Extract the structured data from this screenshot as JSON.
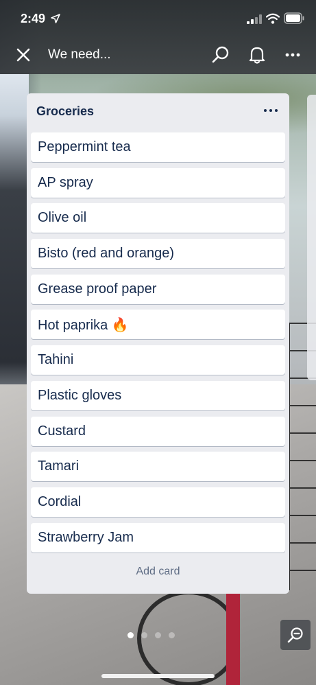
{
  "status_bar": {
    "time": "2:49"
  },
  "header": {
    "board_title": "We need..."
  },
  "list": {
    "title": "Groceries",
    "cards": [
      "Peppermint tea",
      "AP spray",
      "Olive oil",
      "Bisto (red and orange)",
      "Grease proof paper",
      "Hot paprika 🔥",
      "Tahini",
      "Plastic gloves",
      "Custard",
      "Tamari",
      "Cordial",
      "Strawberry Jam"
    ],
    "add_card_label": "Add card"
  },
  "pagination": {
    "total": 4,
    "active_index": 0
  },
  "icons": {
    "close": "close-icon",
    "search": "search-icon",
    "notifications": "bell-icon",
    "more": "more-icon",
    "list_menu": "more-icon",
    "zoom": "zoom-out-icon"
  },
  "colors": {
    "list_bg": "#ebecf0",
    "card_text": "#172b4d",
    "add_card_text": "#5e6c84"
  }
}
